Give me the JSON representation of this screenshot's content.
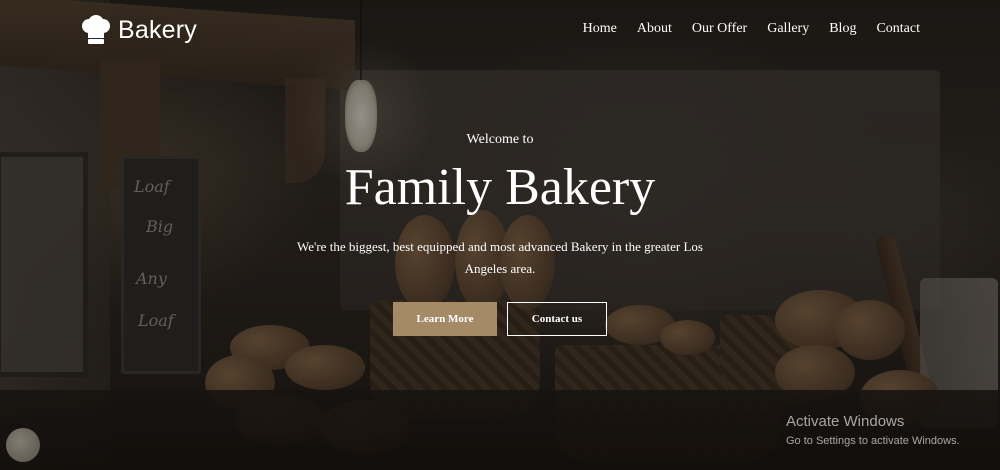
{
  "brand": {
    "name": "Bakery",
    "icon": "chef-hat-icon"
  },
  "nav": {
    "items": [
      {
        "label": "Home"
      },
      {
        "label": "About"
      },
      {
        "label": "Our Offer"
      },
      {
        "label": "Gallery"
      },
      {
        "label": "Blog"
      },
      {
        "label": "Contact"
      }
    ]
  },
  "hero": {
    "welcome": "Welcome to",
    "title": "Family Bakery",
    "description": "We're the biggest, best equipped and most advanced Bakery in the greater Los Angeles area.",
    "primary_button": "Learn More",
    "secondary_button": "Contact us"
  },
  "watermark": {
    "title": "Activate Windows",
    "subtitle": "Go to Settings to activate Windows."
  },
  "colors": {
    "accent": "#a48a67",
    "text": "#ffffff"
  }
}
